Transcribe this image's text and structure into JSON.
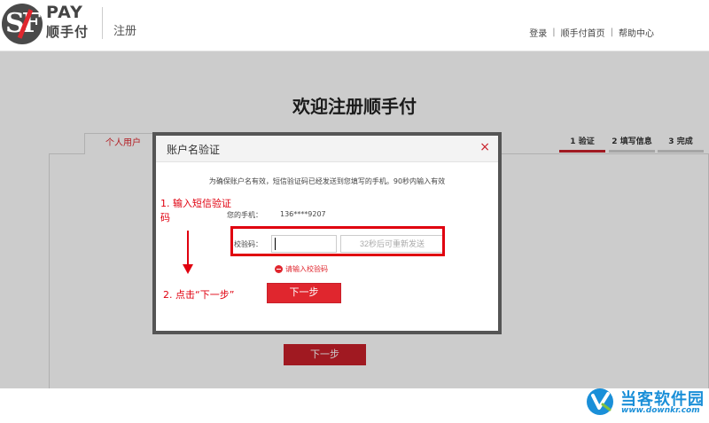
{
  "header": {
    "logo_pay": "PAY",
    "logo_cn": "顺手付",
    "title": "注册",
    "links": [
      "登录",
      "顺手付首页",
      "帮助中心"
    ],
    "link_separator": "|"
  },
  "page": {
    "title": "欢迎注册顺手付",
    "tab_personal": "个人用户",
    "steps": [
      {
        "label": "1 验证",
        "active": true
      },
      {
        "label": "2 填写信息",
        "active": false
      },
      {
        "label": "3 完成",
        "active": false
      }
    ],
    "next_button": "下一步"
  },
  "modal": {
    "title": "账户名验证",
    "close": "×",
    "info": "为确保账户名有效，短信验证码已经发送到您填写的手机。90秒内输入有效",
    "phone_label": "您的手机：",
    "phone_value": "136****9207",
    "code_label": "校验码：",
    "code_value": "",
    "resend_label": "32秒后可重新发送",
    "error_text": "请输入校验码",
    "next_button": "下一步"
  },
  "annotations": {
    "step1": "1. 输入短信验证码",
    "step2": "2. 点击“下一步”"
  },
  "watermark": {
    "name": "当客软件园",
    "url": "www.downkr.com"
  },
  "colors": {
    "accent": "#c9202a",
    "annotation": "#e0000f",
    "watermark": "#1a8fd8"
  }
}
